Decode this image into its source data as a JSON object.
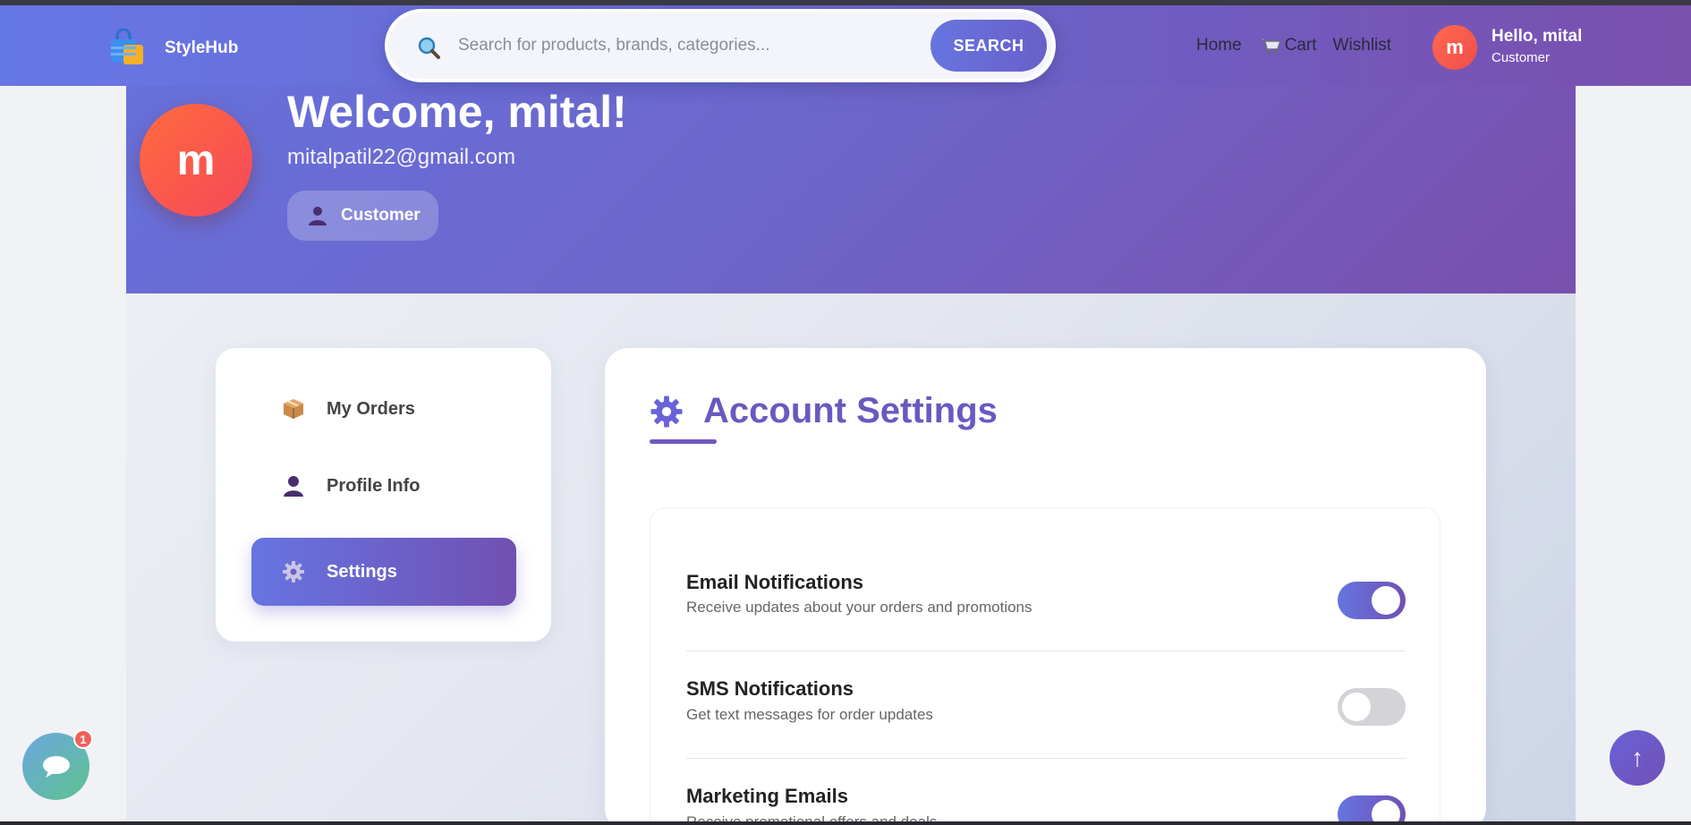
{
  "header": {
    "brand_name": "StyleHub",
    "search_placeholder": "Search for products, brands, categories...",
    "search_button": "SEARCH",
    "nav": {
      "home": "Home",
      "cart": "Cart",
      "wishlist": "Wishlist"
    },
    "user": {
      "avatar_letter": "m",
      "greeting": "Hello, mital",
      "role": "Customer"
    }
  },
  "hero": {
    "avatar_letter": "m",
    "title": "Welcome, mital!",
    "email": "mitalpatil22@gmail.com",
    "badge": "Customer"
  },
  "sidebar": {
    "items": [
      {
        "label": "My Orders",
        "icon": "package-icon",
        "active": false
      },
      {
        "label": "Profile Info",
        "icon": "user-icon",
        "active": false
      },
      {
        "label": "Settings",
        "icon": "gear-icon",
        "active": true
      }
    ]
  },
  "settings": {
    "title": "Account Settings",
    "items": [
      {
        "title": "Email Notifications",
        "description": "Receive updates about your orders and promotions",
        "enabled": true
      },
      {
        "title": "SMS Notifications",
        "description": "Get text messages for order updates",
        "enabled": false
      },
      {
        "title": "Marketing Emails",
        "description": "Receive promotional offers and deals",
        "enabled": true
      }
    ]
  },
  "chat": {
    "badge_count": "1"
  },
  "scroll_top": {
    "label": "↑"
  },
  "colors": {
    "accent": "#6b58c0",
    "header_start": "#6677e6",
    "header_end": "#7a4fae",
    "avatar": "#ff6a4d"
  }
}
